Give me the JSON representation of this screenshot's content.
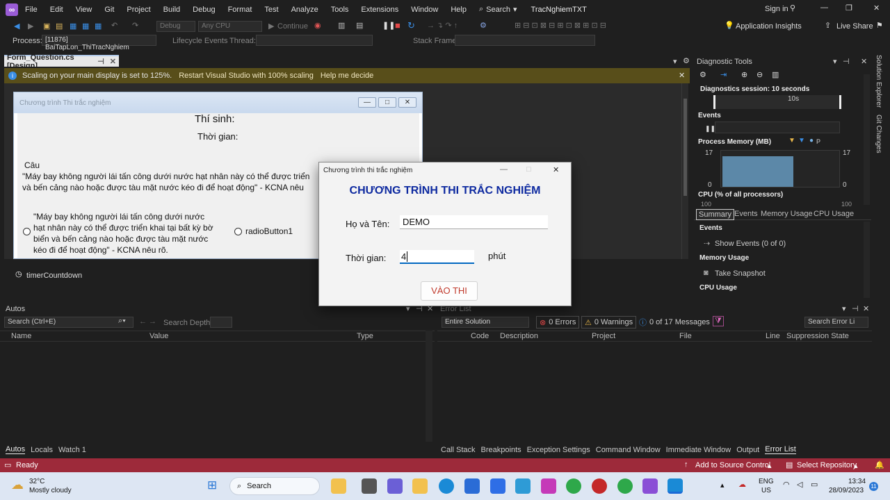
{
  "menubar": {
    "items": [
      "File",
      "Edit",
      "View",
      "Git",
      "Project",
      "Build",
      "Debug",
      "Format",
      "Test",
      "Analyze",
      "Tools",
      "Extensions",
      "Window",
      "Help"
    ],
    "search": "Search",
    "solution": "TracNghiemTXT",
    "signin": "Sign in"
  },
  "toolbar": {
    "config": "Debug",
    "platform": "Any CPU",
    "continue": "Continue",
    "insights": "Application Insights",
    "liveshare": "Live Share"
  },
  "procbar": {
    "process_label": "Process:",
    "process_value": "[11876] BaiTapLon_ThiTracNghiem",
    "lifecycle": "Lifecycle Events",
    "thread": "Thread:",
    "stackframe": "Stack Frame:"
  },
  "doc": {
    "tab": "Form_Question.cs [Design]",
    "pin": "⊣",
    "close": "✕"
  },
  "info": {
    "message": "Scaling on your main display is set to 125%.",
    "restart": "Restart Visual Studio with 100% scaling",
    "help": "Help me decide"
  },
  "form": {
    "title": "Chương trình Thi trắc nghiệm",
    "thisinh": "Thí sinh:",
    "thoigian": "Thời gian:",
    "cau": "Câu",
    "question": "\"Máy bay không người lái tấn công dưới nước hạt nhân này có thể được triển",
    "question2": "và bến cảng nào hoặc được tàu mặt nước kéo đi để hoạt động\" - KCNA nêu",
    "option1_l1": "\"Máy bay không người lái tấn công dưới nước",
    "option1_l2": "hạt nhân này có thể được triển khai tại bất kỳ bờ",
    "option1_l3": "biển và bến cảng nào hoặc được tàu mặt nước",
    "option1_l4": "kéo đi để hoạt động\" - KCNA nêu rõ.",
    "option2": "radioButton1"
  },
  "tray": {
    "timer": "timerCountdown"
  },
  "dialog": {
    "title": "Chương trình thi trắc nghiệm",
    "heading": "CHƯƠNG TRÌNH THI TRẮC NGHIỆM",
    "name_label": "Họ và Tên:",
    "name_value": "DEMO",
    "time_label": "Thời gian:",
    "time_value": "4",
    "unit": "phút",
    "button": "VÀO THI"
  },
  "diag": {
    "title": "Diagnostic Tools",
    "session": "Diagnostics session: 10 seconds",
    "tick": "10s",
    "events": "Events",
    "memory": "Process Memory (MB)",
    "mem_top": "17",
    "mem_bottom": "0",
    "mem_legend_p": "P",
    "cpu": "CPU (% of all processors)",
    "cpu_left": "100",
    "cpu_right": "100",
    "tabs": [
      "Summary",
      "Events",
      "Memory Usage",
      "CPU Usage"
    ],
    "sec_events": "Events",
    "show_events": "Show Events (0 of 0)",
    "sec_memory": "Memory Usage",
    "snapshot": "Take Snapshot",
    "sec_cpu": "CPU Usage",
    "memory_level": 0.85
  },
  "rail": {
    "solution_explorer": "Solution Explorer",
    "git_changes": "Git Changes"
  },
  "autos": {
    "title": "Autos",
    "search": "Search (Ctrl+E)",
    "depth": "Search Depth:",
    "cols": [
      "Name",
      "Value",
      "Type"
    ],
    "tabs": [
      "Autos",
      "Locals",
      "Watch 1"
    ]
  },
  "errors": {
    "title": "Error List",
    "scope": "Entire Solution",
    "errors": "0 Errors",
    "warnings": "0 Warnings",
    "messages": "0 of 17 Messages",
    "search": "Search Error Li",
    "cols": [
      "Code",
      "Description",
      "Project",
      "File",
      "Line",
      "Suppression State"
    ],
    "tabs": [
      "Call Stack",
      "Breakpoints",
      "Exception Settings",
      "Command Window",
      "Immediate Window",
      "Output",
      "Error List"
    ]
  },
  "status": {
    "ready": "Ready",
    "source": "Add to Source Control",
    "repo": "Select Repository"
  },
  "taskbar": {
    "temp": "32°C",
    "weather": "Mostly cloudy",
    "search": "Search",
    "lang1": "ENG",
    "lang2": "US",
    "time": "13:34",
    "date": "28/09/2023",
    "badge": "11"
  },
  "colors": {
    "accent": "#0e2aa0",
    "status": "#9d2a3a",
    "button_text": "#c0392b"
  }
}
